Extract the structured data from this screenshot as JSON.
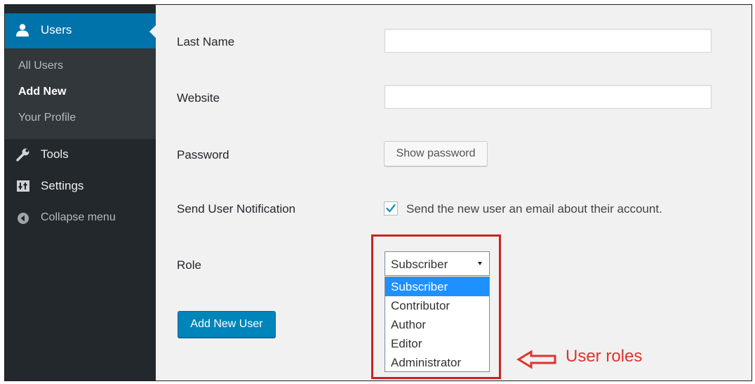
{
  "sidebar": {
    "users_label": "Users",
    "submenu": [
      "All Users",
      "Add New",
      "Your Profile"
    ],
    "current_submenu": "Add New",
    "tools_label": "Tools",
    "settings_label": "Settings",
    "collapse_label": "Collapse menu",
    "icons": [
      "user-icon",
      "wrench-icon",
      "settings-icon",
      "collapse-icon"
    ]
  },
  "form": {
    "last_name_label": "Last Name",
    "last_name_value": "",
    "website_label": "Website",
    "website_value": "",
    "password_label": "Password",
    "show_password_button": "Show password",
    "notification_label": "Send User Notification",
    "notification_checked": true,
    "notification_text": "Send the new user an email about their account.",
    "role_label": "Role",
    "role_selected": "Subscriber",
    "role_options": [
      "Subscriber",
      "Contributor",
      "Author",
      "Editor",
      "Administrator"
    ],
    "submit_button": "Add New User"
  },
  "annotation": {
    "text": "User roles"
  },
  "colors": {
    "sidebar_bg": "#23282d",
    "submenu_bg": "#32373c",
    "accent": "#0073aa",
    "primary_button": "#0085ba",
    "annotation_red": "#cc2222",
    "selected_option": "#1e90ff"
  }
}
